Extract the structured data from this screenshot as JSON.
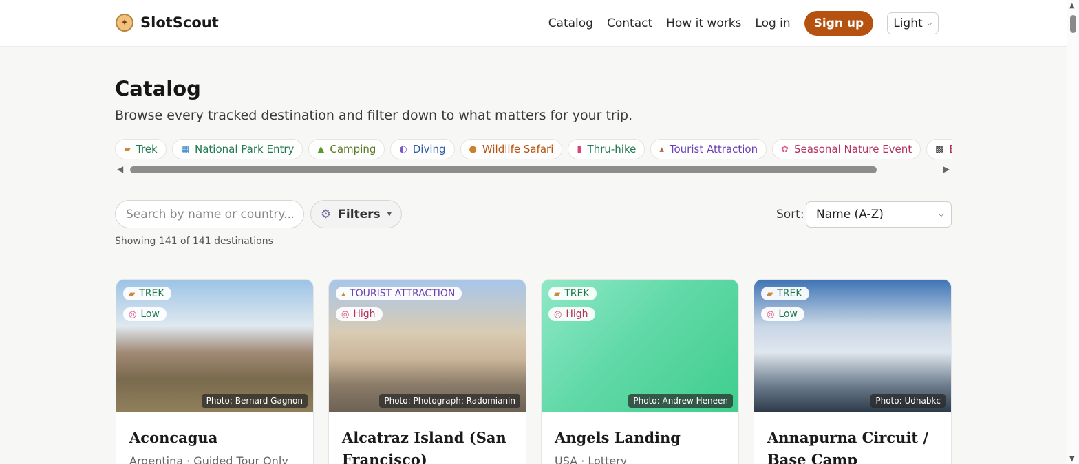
{
  "header": {
    "brand": "SlotScout",
    "nav": [
      "Catalog",
      "Contact",
      "How it works",
      "Log in"
    ],
    "signup": "Sign up",
    "theme": "Light"
  },
  "page": {
    "title": "Catalog",
    "subtitle": "Browse every tracked destination and filter down to what matters for your trip."
  },
  "chips": [
    {
      "label": "Trek",
      "icon": "boot",
      "color": "#1f7a4d"
    },
    {
      "label": "National Park Entry",
      "icon": "park",
      "color": "#1f7a4d"
    },
    {
      "label": "Camping",
      "icon": "tent",
      "color": "#5a7a1f"
    },
    {
      "label": "Diving",
      "icon": "mask",
      "color": "#2a5aa8"
    },
    {
      "label": "Wildlife Safari",
      "icon": "lion",
      "color": "#b5520f"
    },
    {
      "label": "Thru-hike",
      "icon": "backpack",
      "color": "#1f7a4d"
    },
    {
      "label": "Tourist Attraction",
      "icon": "tower",
      "color": "#6a3fb5"
    },
    {
      "label": "Seasonal Nature Event",
      "icon": "blossom",
      "color": "#b5315a"
    },
    {
      "label": "Endu",
      "icon": "flag",
      "color": "#b5315a"
    }
  ],
  "controls": {
    "search_placeholder": "Search by name or country...",
    "filters": "Filters",
    "sort_label": "Sort:",
    "sort_value": "Name (A-Z)",
    "showing": "Showing 141 of 141 destinations"
  },
  "cards": [
    {
      "type": "TREK",
      "type_color": "#1f7a4d",
      "level": "Low",
      "level_color": "#1f7a4d",
      "credit": "Photo: Bernard Gagnon",
      "title": "Aconcagua",
      "meta": "Argentina · Guided Tour Only"
    },
    {
      "type": "TOURIST ATTRACTION",
      "type_color": "#6a3fb5",
      "level": "High",
      "level_color": "#b5315a",
      "credit": "Photo: Photograph: Radomianin",
      "title": "Alcatraz Island (San Francisco)",
      "meta": ""
    },
    {
      "type": "TREK",
      "type_color": "#1f7a4d",
      "level": "High",
      "level_color": "#b5315a",
      "credit": "Photo: Andrew Heneen",
      "title": "Angels Landing",
      "meta": "USA · Lottery"
    },
    {
      "type": "TREK",
      "type_color": "#1f7a4d",
      "level": "Low",
      "level_color": "#1f7a4d",
      "credit": "Photo: Udhabkc",
      "title": "Annapurna Circuit / Base Camp",
      "meta": ""
    }
  ]
}
